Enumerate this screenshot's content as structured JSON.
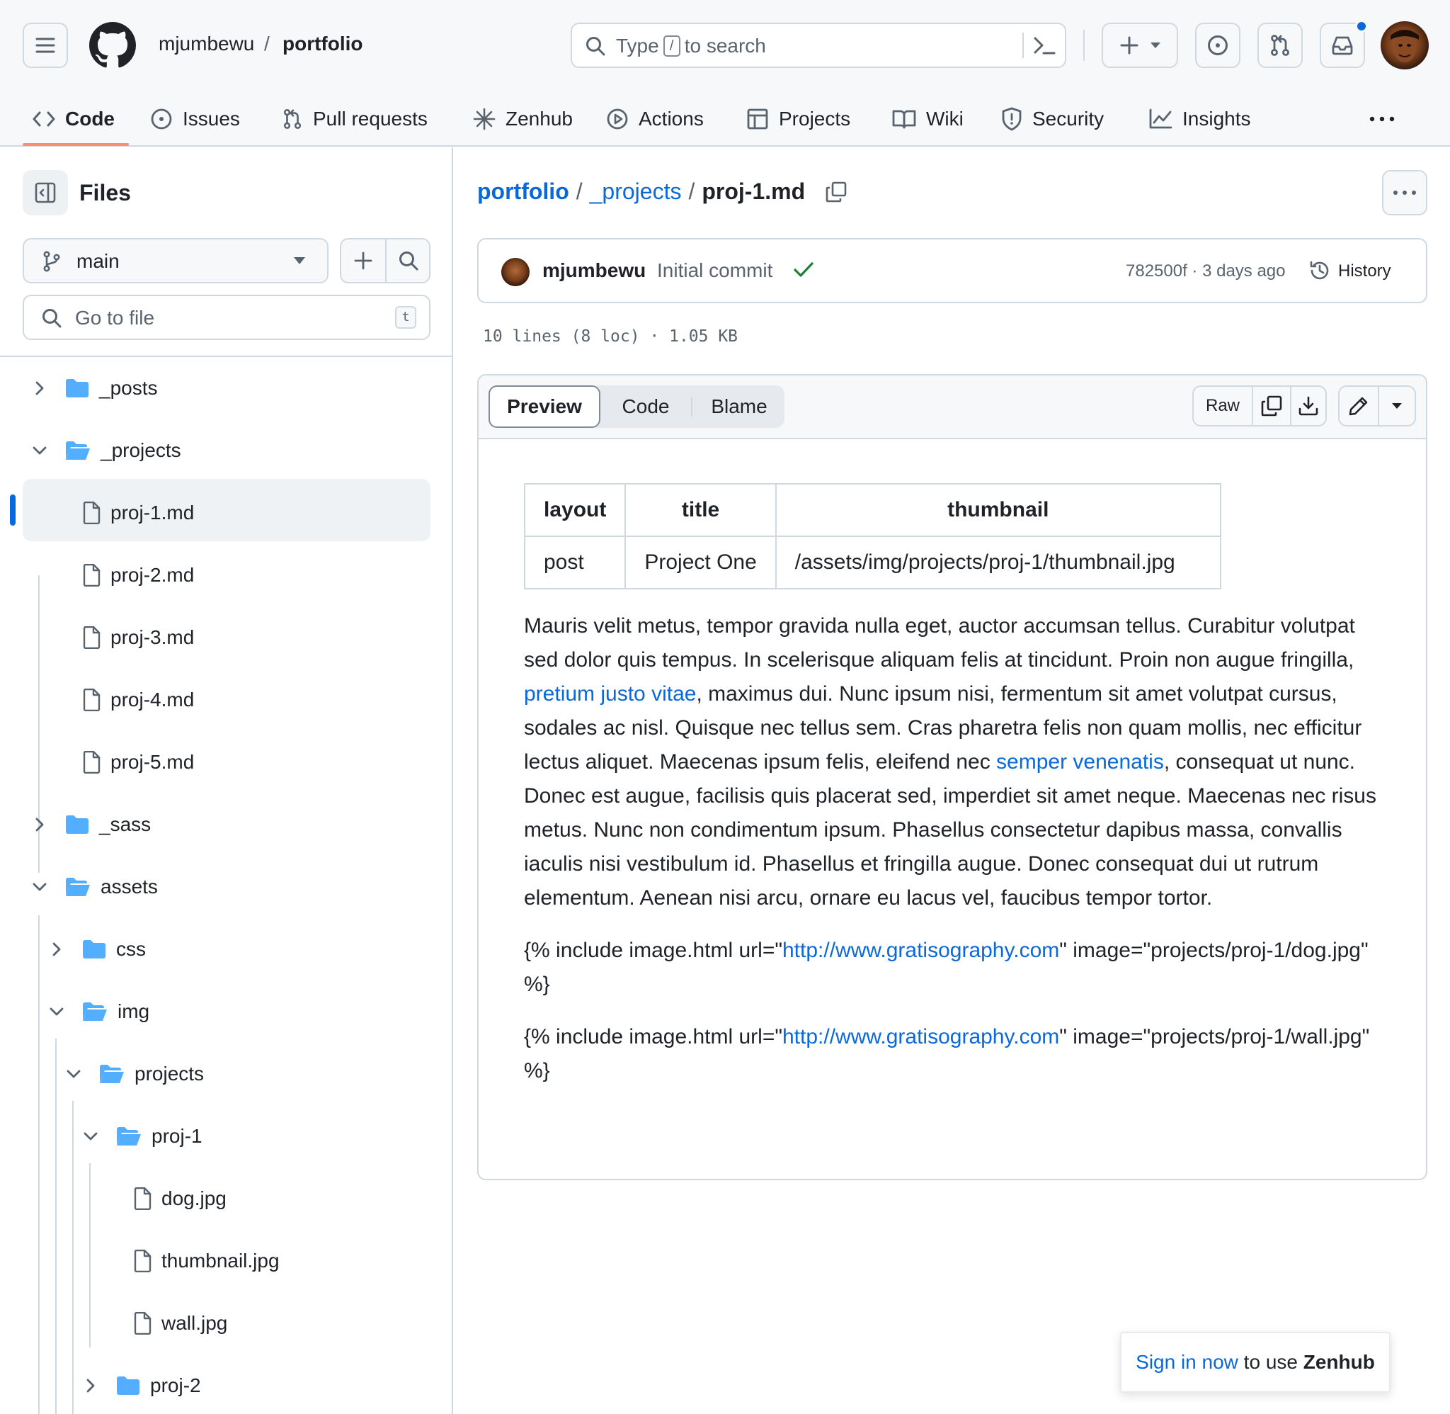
{
  "header": {
    "owner": "mjumbewu",
    "separator": "/",
    "repo": "portfolio",
    "search": {
      "before": "Type",
      "key": "/",
      "after": "to search"
    }
  },
  "repo_tabs": [
    {
      "label": "Code",
      "icon": "code-icon"
    },
    {
      "label": "Issues",
      "icon": "issue-icon"
    },
    {
      "label": "Pull requests",
      "icon": "pull-request-icon"
    },
    {
      "label": "Zenhub",
      "icon": "zenhub-icon"
    },
    {
      "label": "Actions",
      "icon": "play-icon"
    },
    {
      "label": "Projects",
      "icon": "table-icon"
    },
    {
      "label": "Wiki",
      "icon": "book-icon"
    },
    {
      "label": "Security",
      "icon": "shield-icon"
    },
    {
      "label": "Insights",
      "icon": "graph-icon"
    }
  ],
  "sidebar": {
    "title": "Files",
    "branch": "main",
    "goto_placeholder": "Go to file",
    "goto_key": "t",
    "tree": [
      {
        "name": "_posts",
        "type": "folder",
        "expanded": false
      },
      {
        "name": "_projects",
        "type": "folder",
        "expanded": true
      },
      {
        "name": "proj-1.md",
        "type": "file",
        "selected": true
      },
      {
        "name": "proj-2.md",
        "type": "file"
      },
      {
        "name": "proj-3.md",
        "type": "file"
      },
      {
        "name": "proj-4.md",
        "type": "file"
      },
      {
        "name": "proj-5.md",
        "type": "file"
      },
      {
        "name": "_sass",
        "type": "folder",
        "expanded": false
      },
      {
        "name": "assets",
        "type": "folder",
        "expanded": true
      },
      {
        "name": "css",
        "type": "folder",
        "expanded": false
      },
      {
        "name": "img",
        "type": "folder",
        "expanded": true
      },
      {
        "name": "projects",
        "type": "folder",
        "expanded": true
      },
      {
        "name": "proj-1",
        "type": "folder",
        "expanded": true
      },
      {
        "name": "dog.jpg",
        "type": "file"
      },
      {
        "name": "thumbnail.jpg",
        "type": "file"
      },
      {
        "name": "wall.jpg",
        "type": "file"
      },
      {
        "name": "proj-2",
        "type": "folder",
        "expanded": false
      }
    ]
  },
  "breadcrumb": {
    "repo": "portfolio",
    "sep": "/",
    "dir": "_projects",
    "file": "proj-1.md"
  },
  "commit": {
    "author": "mjumbewu",
    "message": "Initial commit",
    "meta": "782500f · 3 days ago",
    "history_label": "History"
  },
  "file_info": "10 lines (8 loc) · 1.05 KB",
  "view_tabs": {
    "preview": "Preview",
    "code": "Code",
    "blame": "Blame",
    "raw": "Raw"
  },
  "front_matter": {
    "headers": [
      "layout",
      "title",
      "thumbnail"
    ],
    "row": [
      "post",
      "Project One",
      "/assets/img/projects/proj-1/thumbnail.jpg"
    ]
  },
  "body": {
    "p1_a": "Mauris velit metus, tempor gravida nulla eget, auctor accumsan tellus. Curabitur volutpat sed dolor quis tempus. In scelerisque aliquam felis at tincidunt. Proin non augue fringilla, ",
    "p1_link1": "pretium justo vitae",
    "p1_b": ", maximus dui. Nunc ipsum nisi, fermentum sit amet volutpat cursus, sodales ac nisl. Quisque nec tellus sem. Cras pharetra felis non quam mollis, nec efficitur lectus aliquet. Maecenas ipsum felis, eleifend nec ",
    "p1_link2": "semper venenatis",
    "p1_c": ", consequat ut nunc. Donec est augue, facilisis quis placerat sed, imperdiet sit amet neque. Maecenas nec risus metus. Nunc non condimentum ipsum. Phasellus consectetur dapibus massa, convallis iaculis nisi vestibulum id. Phasellus et fringilla augue. Donec consequat dui ut rutrum elementum. Aenean nisi arcu, ornare eu lacus vel, faucibus tempor tortor.",
    "p2_a": "{% include image.html url=\"",
    "p2_link": "http://www.gratisography.com",
    "p2_b": "\" image=\"projects/proj-1/dog.jpg\" %}",
    "p3_a": "{% include image.html url=\"",
    "p3_link": "http://www.gratisography.com",
    "p3_b": "\" image=\"projects/proj-1/wall.jpg\" %}"
  },
  "zenhub_banner": {
    "link": "Sign in now",
    "mid": " to use ",
    "brand": "Zenhub"
  },
  "colors": {
    "accent": "#0969da",
    "tab_underline": "#fd8c73",
    "success": "#1a7f37",
    "folder": "#54aeff"
  }
}
